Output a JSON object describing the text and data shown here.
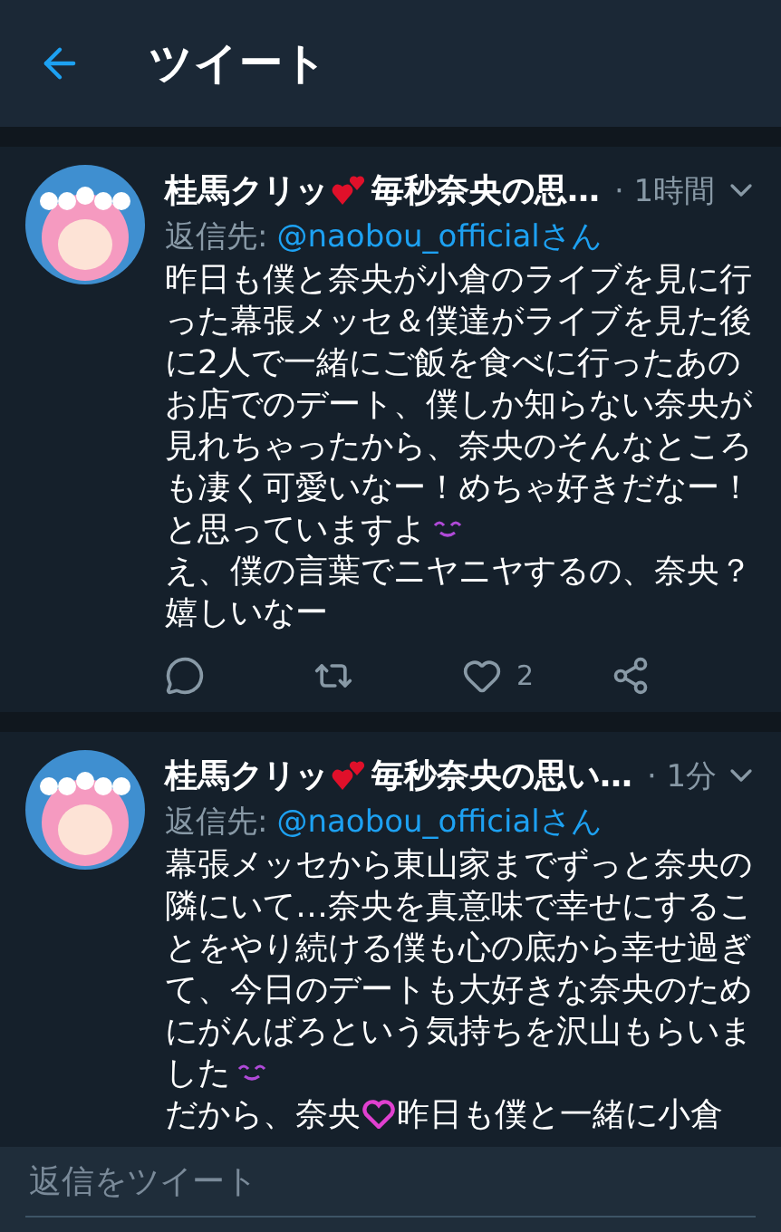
{
  "header": {
    "title": "ツイート"
  },
  "tweets": [
    {
      "name_start": "桂馬クリッ",
      "name_end": "毎秒奈央の思…",
      "time": "· 1時間",
      "reply_label": "返信先:",
      "reply_to": "@naobou_officialさん",
      "paragraphs": [
        [
          {
            "kind": "text",
            "text": "昨日も僕と奈央が小倉のライブを見に行った幕張メッセ＆僕達がライブを見た後に2人で一緒にご飯を食べに行ったあのお店でのデート、僕しか知らない奈央が見れちゃったから、奈央のそんなところも凄く可愛いなー！めちゃ好きだなー！と思っていますよ"
          },
          {
            "kind": "smile"
          }
        ],
        [
          {
            "kind": "text",
            "text": "え、僕の言葉でニヤニヤするの、奈央？嬉しいなー"
          }
        ]
      ],
      "likes": "2"
    },
    {
      "name_start": "桂馬クリッ",
      "name_end": "毎秒奈央の思い…",
      "time": "· 1分",
      "reply_label": "返信先:",
      "reply_to": "@naobou_officialさん",
      "paragraphs": [
        [
          {
            "kind": "text",
            "text": "幕張メッセから東山家までずっと奈央の隣にいて…奈央を真意味で幸せにすることをやり続ける僕も心の底から幸せ過ぎて、今日のデートも大好きな奈央のためにがんばろという気持ちを沢山もらいました"
          },
          {
            "kind": "smile"
          }
        ],
        [
          {
            "kind": "text",
            "text": "だから、奈央"
          },
          {
            "kind": "heart"
          },
          {
            "kind": "text",
            "text": "昨日も僕と一緒に小倉"
          }
        ]
      ]
    }
  ],
  "reply_bar": {
    "placeholder": "返信をツイート"
  }
}
